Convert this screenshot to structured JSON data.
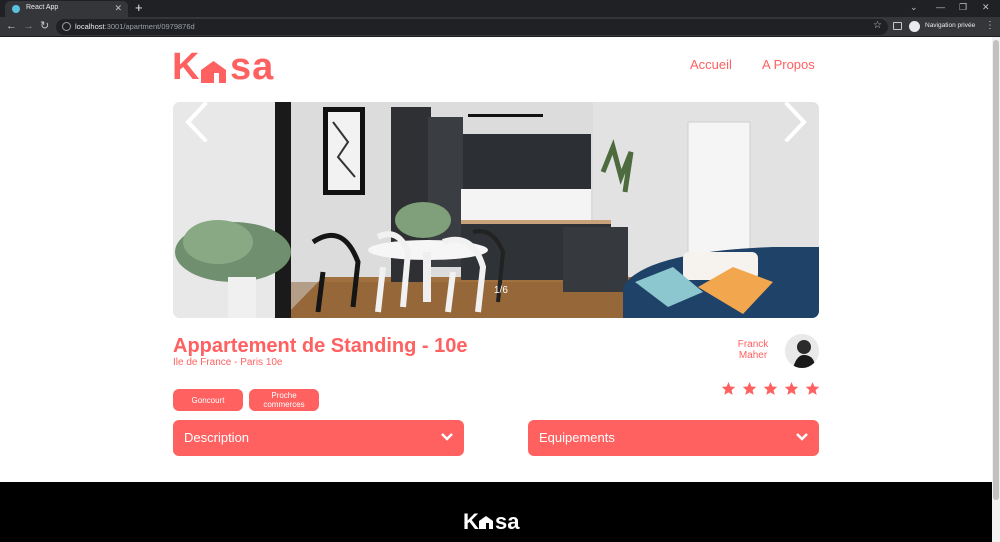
{
  "browser": {
    "tab_title": "React App",
    "tab_close": "✕",
    "new_tab": "+",
    "url_host": "localhost",
    "url_rest": ":3001/apartment/0979876d",
    "private_label": "Navigation privée",
    "win_minimize": "—",
    "win_restore": "❐",
    "win_close": "✕",
    "menu": "⋮"
  },
  "header": {
    "logo_left": "K",
    "logo_right": "sa",
    "nav": [
      "Accueil",
      "A Propos"
    ]
  },
  "gallery": {
    "counter": "1/6"
  },
  "listing": {
    "title": "Appartement de Standing - 10e",
    "location": "Ile de France - Paris 10e",
    "tags": [
      "Goncourt",
      "Proche commerces"
    ],
    "rating": 5,
    "rating_max": 5
  },
  "host": {
    "first_name": "Franck",
    "last_name": "Maher"
  },
  "collapses": [
    {
      "label": "Description"
    },
    {
      "label": "Equipements"
    }
  ],
  "footer": {
    "logo_left": "K",
    "logo_right": "sa"
  },
  "colors": {
    "brand": "#ff6060",
    "footer_bg": "#000000"
  }
}
